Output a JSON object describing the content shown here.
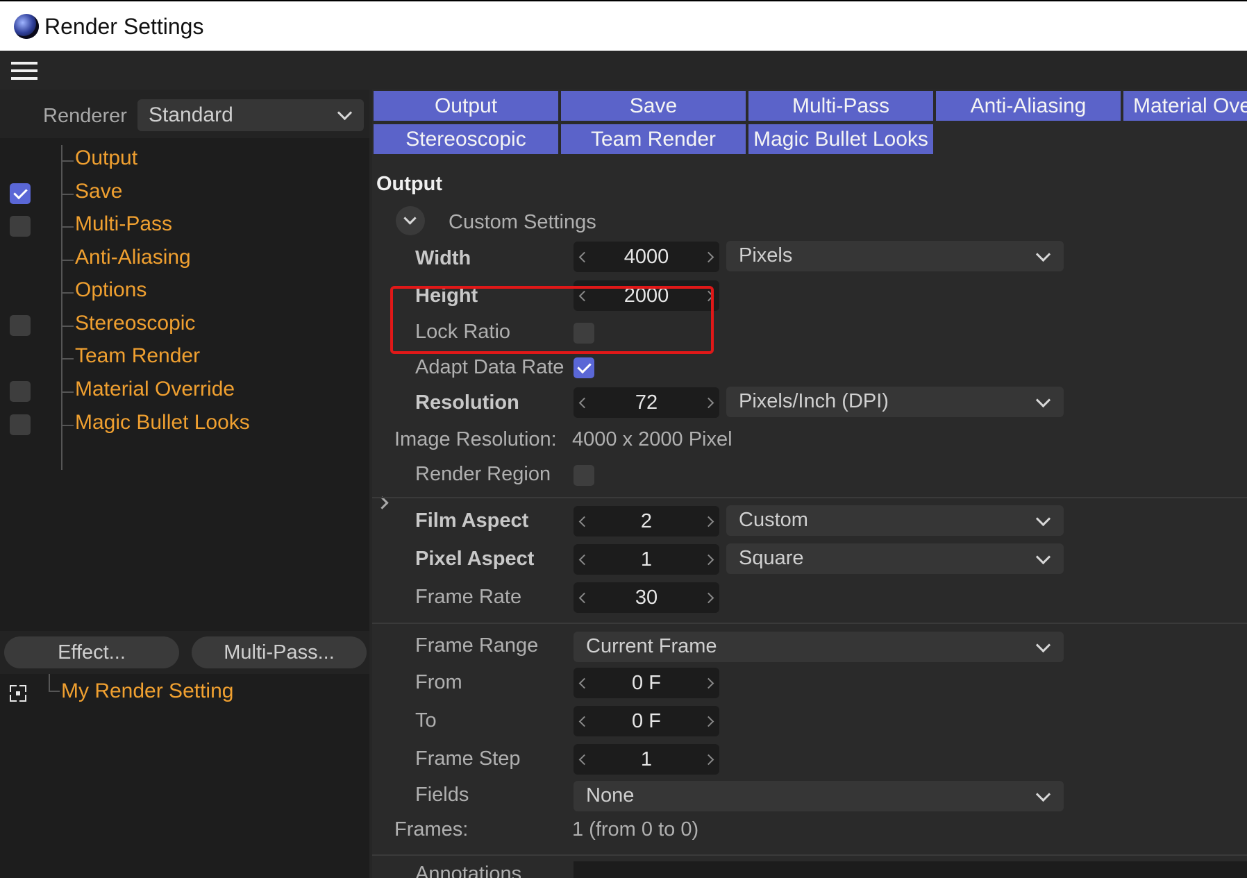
{
  "window": {
    "title": "Render Settings"
  },
  "left": {
    "renderer_label": "Renderer",
    "renderer_value": "Standard",
    "tree": [
      {
        "label": "Output",
        "checkbox": "none"
      },
      {
        "label": "Save",
        "checkbox": "checked"
      },
      {
        "label": "Multi-Pass",
        "checkbox": "unchecked"
      },
      {
        "label": "Anti-Aliasing",
        "checkbox": "none"
      },
      {
        "label": "Options",
        "checkbox": "none"
      },
      {
        "label": "Stereoscopic",
        "checkbox": "unchecked"
      },
      {
        "label": "Team Render",
        "checkbox": "none"
      },
      {
        "label": "Material Override",
        "checkbox": "unchecked"
      },
      {
        "label": "Magic Bullet Looks",
        "checkbox": "unchecked"
      }
    ],
    "effect_button": "Effect...",
    "multipass_button": "Multi-Pass...",
    "render_setting": "My Render Setting"
  },
  "tabs": [
    "Output",
    "Save",
    "Multi-Pass",
    "Anti-Aliasing",
    "Material Ove",
    "Stereoscopic",
    "Team Render",
    "Magic Bullet Looks"
  ],
  "output": {
    "section_title": "Output",
    "preset": "Custom Settings",
    "width_label": "Width",
    "width_value": "4000",
    "height_label": "Height",
    "height_value": "2000",
    "size_unit": "Pixels",
    "lock_ratio_label": "Lock Ratio",
    "lock_ratio": false,
    "adapt_label": "Adapt Data Rate",
    "adapt": true,
    "resolution_label": "Resolution",
    "resolution_value": "72",
    "resolution_unit": "Pixels/Inch (DPI)",
    "image_res_label": "Image Resolution:",
    "image_res_value": "4000 x 2000 Pixel",
    "render_region_label": "Render Region",
    "render_region": false,
    "film_aspect_label": "Film Aspect",
    "film_aspect_value": "2",
    "film_aspect_preset": "Custom",
    "pixel_aspect_label": "Pixel Aspect",
    "pixel_aspect_value": "1",
    "pixel_aspect_preset": "Square",
    "frame_rate_label": "Frame Rate",
    "frame_rate_value": "30",
    "frame_range_label": "Frame Range",
    "frame_range_value": "Current Frame",
    "from_label": "From",
    "from_value": "0 F",
    "to_label": "To",
    "to_value": "0 F",
    "frame_step_label": "Frame Step",
    "frame_step_value": "1",
    "fields_label": "Fields",
    "fields_value": "None",
    "frames_label": "Frames:",
    "frames_value": "1 (from 0 to 0)",
    "annotations_label": "Annotations"
  },
  "colors": {
    "accent": "#5b63c9",
    "tree_text": "#f0a030",
    "highlight": "#e01818"
  }
}
